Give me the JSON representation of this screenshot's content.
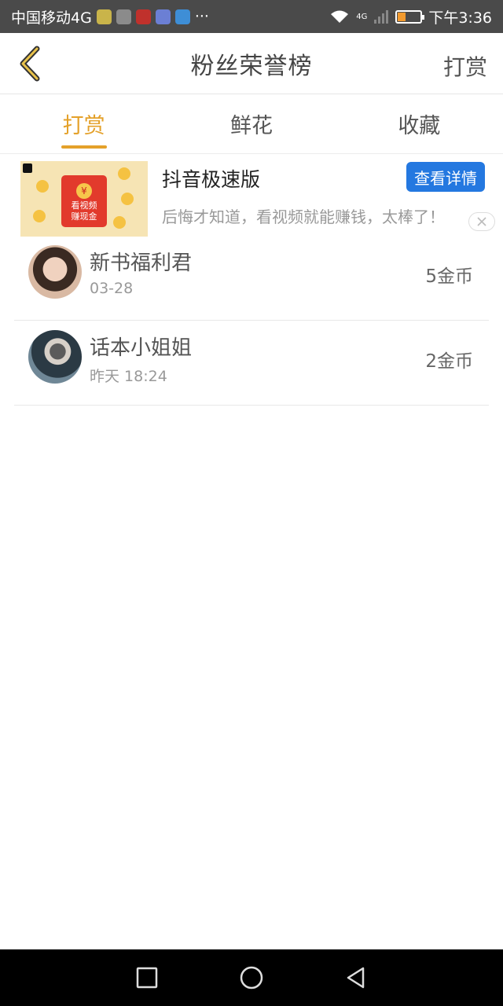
{
  "status_bar": {
    "carrier": "中国移动4G",
    "more": "···",
    "network": "4G",
    "time": "下午3:36",
    "battery_level": 0.3,
    "app_icons": [
      "qq-icon",
      "wechat-icon",
      "book-icon",
      "music-icon",
      "bird-icon"
    ],
    "app_icon_colors": [
      "#c9b44a",
      "#8b8b8b",
      "#c0312c",
      "#6b7fd4",
      "#3e8ed6"
    ]
  },
  "header": {
    "title": "粉丝荣誉榜",
    "right_action": "打赏",
    "accent_color": "#e4a12a"
  },
  "tabs": [
    {
      "label": "打赏",
      "active": true
    },
    {
      "label": "鲜花",
      "active": false
    },
    {
      "label": "收藏",
      "active": false
    }
  ],
  "ad": {
    "title": "抖音极速版",
    "cta": "查看详情",
    "description": "后悔才知道，看视频就能赚钱，太棒了！",
    "image_text_line1": "看视频",
    "image_text_line2": "赚现金",
    "seal": "¥"
  },
  "list": [
    {
      "name": "新书福利君",
      "date": "03-28",
      "amount": "5金币"
    },
    {
      "name": "话本小姐姐",
      "date": "昨天 18:24",
      "amount": "2金币"
    }
  ]
}
